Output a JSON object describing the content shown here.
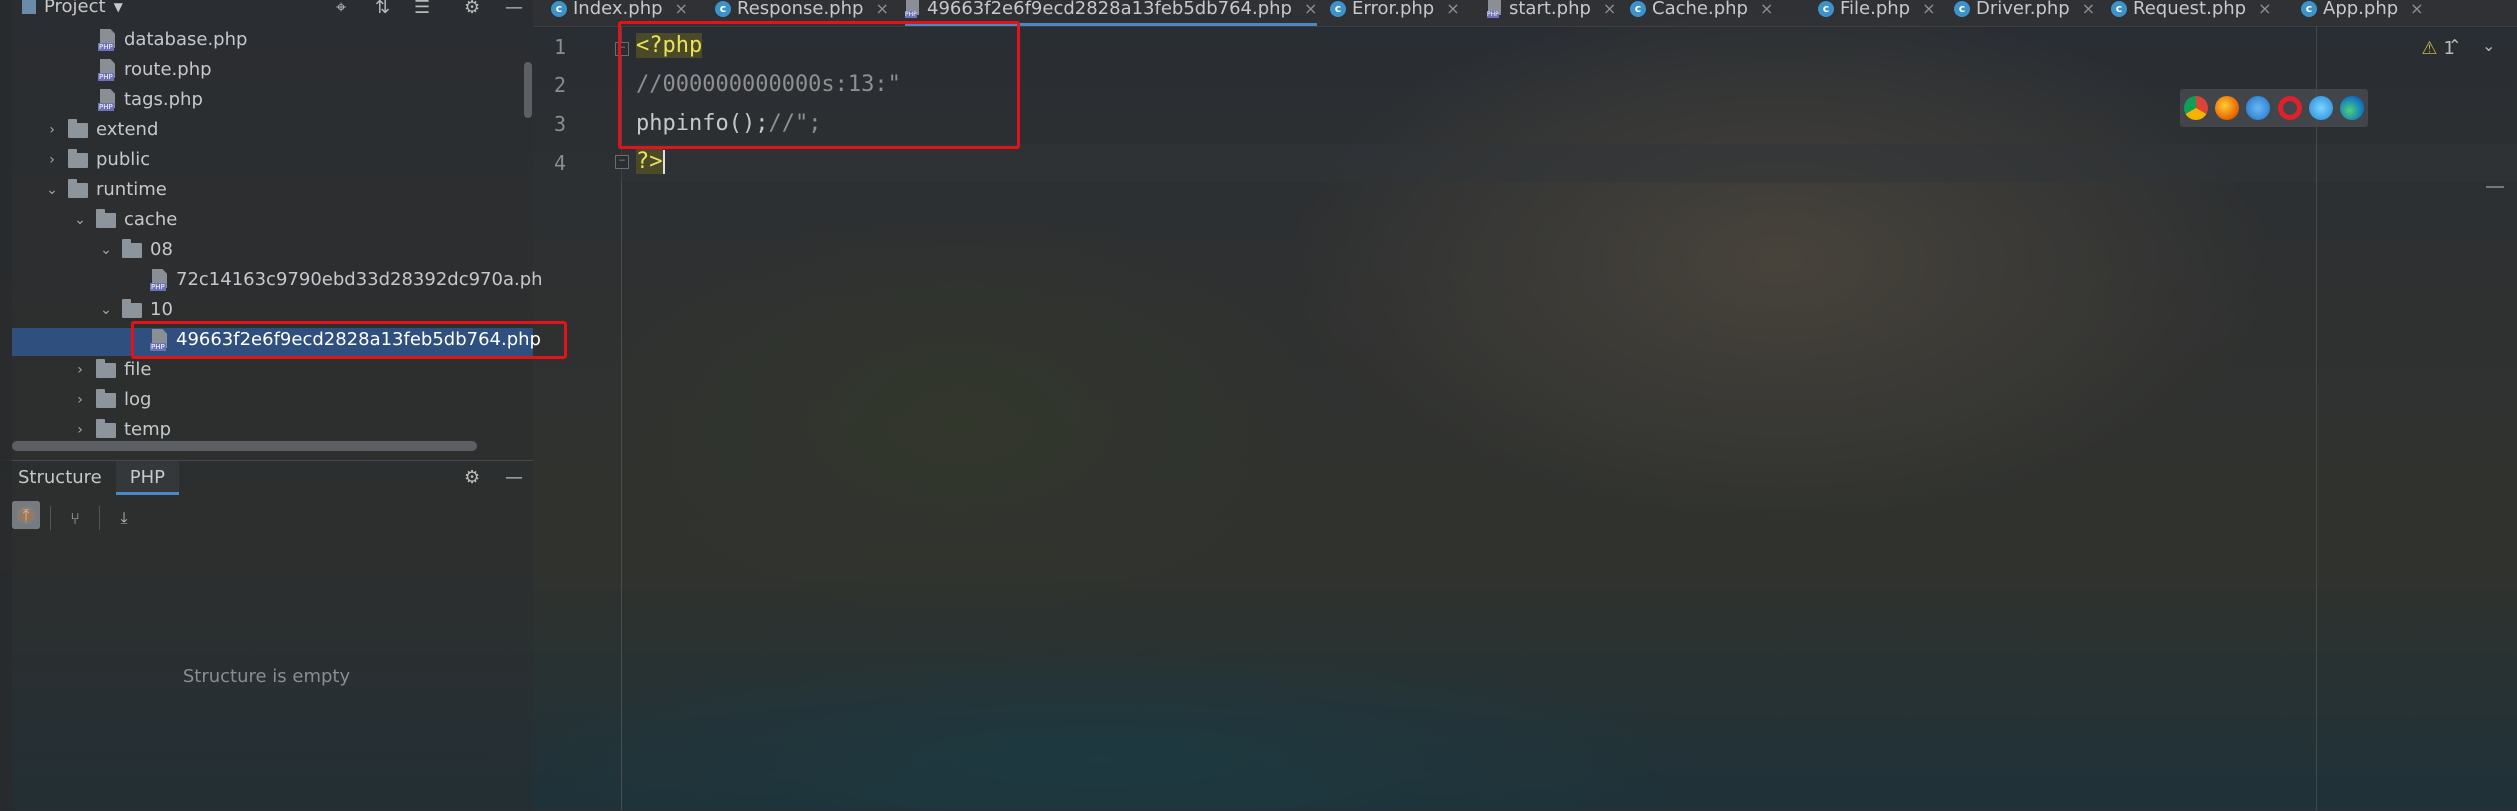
{
  "project_panel": {
    "title": "Project",
    "tree": [
      {
        "label": "database.php",
        "type": "php-file",
        "indent": 3
      },
      {
        "label": "route.php",
        "type": "php-file",
        "indent": 3
      },
      {
        "label": "tags.php",
        "type": "php-file",
        "indent": 3
      },
      {
        "label": "extend",
        "type": "folder",
        "indent": 1,
        "expanded": false
      },
      {
        "label": "public",
        "type": "folder",
        "indent": 1,
        "expanded": false
      },
      {
        "label": "runtime",
        "type": "folder",
        "indent": 1,
        "expanded": true
      },
      {
        "label": "cache",
        "type": "folder",
        "indent": 2,
        "expanded": true
      },
      {
        "label": "08",
        "type": "folder",
        "indent": 3,
        "expanded": true
      },
      {
        "label": "72c14163c9790ebd33d28392dc970a.ph",
        "type": "php-file",
        "indent": 5
      },
      {
        "label": "10",
        "type": "folder",
        "indent": 3,
        "expanded": true
      },
      {
        "label": "49663f2e6f9ecd2828a13feb5db764.php",
        "type": "php-file",
        "indent": 5,
        "selected": true
      },
      {
        "label": "file",
        "type": "folder",
        "indent": 2,
        "expanded": false
      },
      {
        "label": "log",
        "type": "folder",
        "indent": 2,
        "expanded": false
      },
      {
        "label": "temp",
        "type": "folder",
        "indent": 2,
        "expanded": false
      }
    ]
  },
  "structure_panel": {
    "tabs": [
      "Structure",
      "PHP"
    ],
    "active_tab": "PHP",
    "empty_text": "Structure is empty"
  },
  "editor_tabs": [
    {
      "label": "Index.php",
      "icon": "class"
    },
    {
      "label": "Response.php",
      "icon": "class"
    },
    {
      "label": "49663f2e6f9ecd2828a13feb5db764.php",
      "icon": "php",
      "active": true
    },
    {
      "label": "Error.php",
      "icon": "class"
    },
    {
      "label": "start.php",
      "icon": "php"
    },
    {
      "label": "Cache.php",
      "icon": "class"
    },
    {
      "label": "File.php",
      "icon": "class"
    },
    {
      "label": "Driver.php",
      "icon": "class"
    },
    {
      "label": "Request.php",
      "icon": "class"
    },
    {
      "label": "App.php",
      "icon": "class"
    }
  ],
  "editor": {
    "line_numbers": [
      "1",
      "2",
      "3",
      "4"
    ],
    "lines": {
      "l1": "<?php",
      "l2": "//000000000000s:13:\"",
      "l3_fn": "phpinfo();",
      "l3_cmt": "//\";",
      "l4": "?>"
    },
    "warning_count": "1"
  },
  "colors": {
    "selection": "#2f4f7e",
    "highlight_box": "#e3131b",
    "accent": "#4a88c7",
    "php_keyword": "#e8e35a"
  }
}
